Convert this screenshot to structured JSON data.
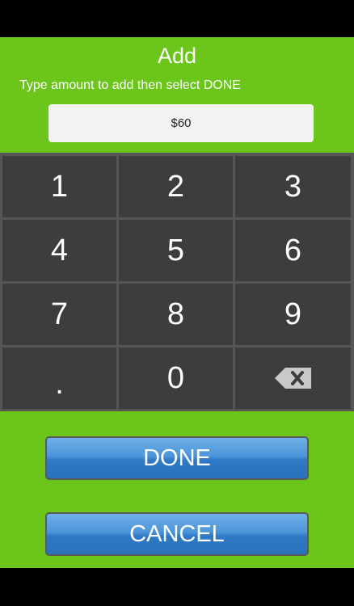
{
  "screen": {
    "title": "Add",
    "instruction": "Type amount to add then select DONE"
  },
  "amount_field": {
    "value": "$60"
  },
  "keypad": {
    "keys": [
      "1",
      "2",
      "3",
      "4",
      "5",
      "6",
      "7",
      "8",
      "9",
      ".",
      "0"
    ],
    "backspace_icon": "backspace-icon"
  },
  "actions": {
    "done_label": "DONE",
    "cancel_label": "CANCEL"
  },
  "colors": {
    "background": "#6cc51b",
    "key": "#3d3d3f",
    "key_gap": "#565656",
    "button": "#3f8bd6"
  }
}
